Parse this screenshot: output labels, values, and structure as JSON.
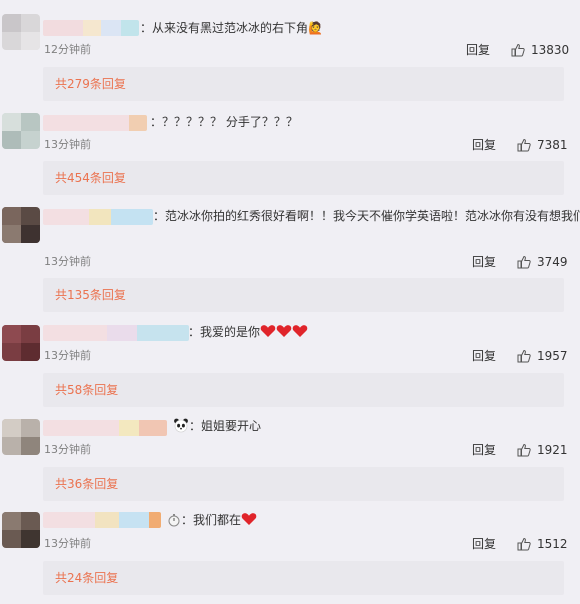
{
  "comments": [
    {
      "text": "：从来没有黑过范冰冰的右下角🙋",
      "time": "12分钟前",
      "reply_label": "回复",
      "likes": "13830",
      "more_replies": "共279条回复"
    },
    {
      "text": "：？？？？？ 分手了？？？",
      "time": "13分钟前",
      "reply_label": "回复",
      "likes": "7381",
      "more_replies": "共454条回复"
    },
    {
      "text": "：范冰冰你拍的红秀很好看啊！！我今天不催你学英语啦！范冰冰你有没有想我们呀？",
      "time": "13分钟前",
      "reply_label": "回复",
      "likes": "3749",
      "more_replies": "共135条回复"
    },
    {
      "text": "：我爱的是你",
      "time": "13分钟前",
      "reply_label": "回复",
      "likes": "1957",
      "more_replies": "共58条回复"
    },
    {
      "text": "：姐姐要开心",
      "time": "13分钟前",
      "reply_label": "回复",
      "likes": "1921",
      "more_replies": "共36条回复"
    },
    {
      "text": "：我们都在",
      "time": "13分钟前",
      "reply_label": "回复",
      "likes": "1512",
      "more_replies": "共24条回复"
    }
  ],
  "icons": {
    "like": "thumbs-up-icon",
    "heart": "red-heart-icon",
    "panda": "panda-icon",
    "emoji_person": "person-raising-hand-icon"
  },
  "colors": {
    "background": "#f0eff4",
    "reply_block": "#e9e8ed",
    "more_link": "#eb7350",
    "time": "#808080",
    "heart": "#e0242a"
  }
}
